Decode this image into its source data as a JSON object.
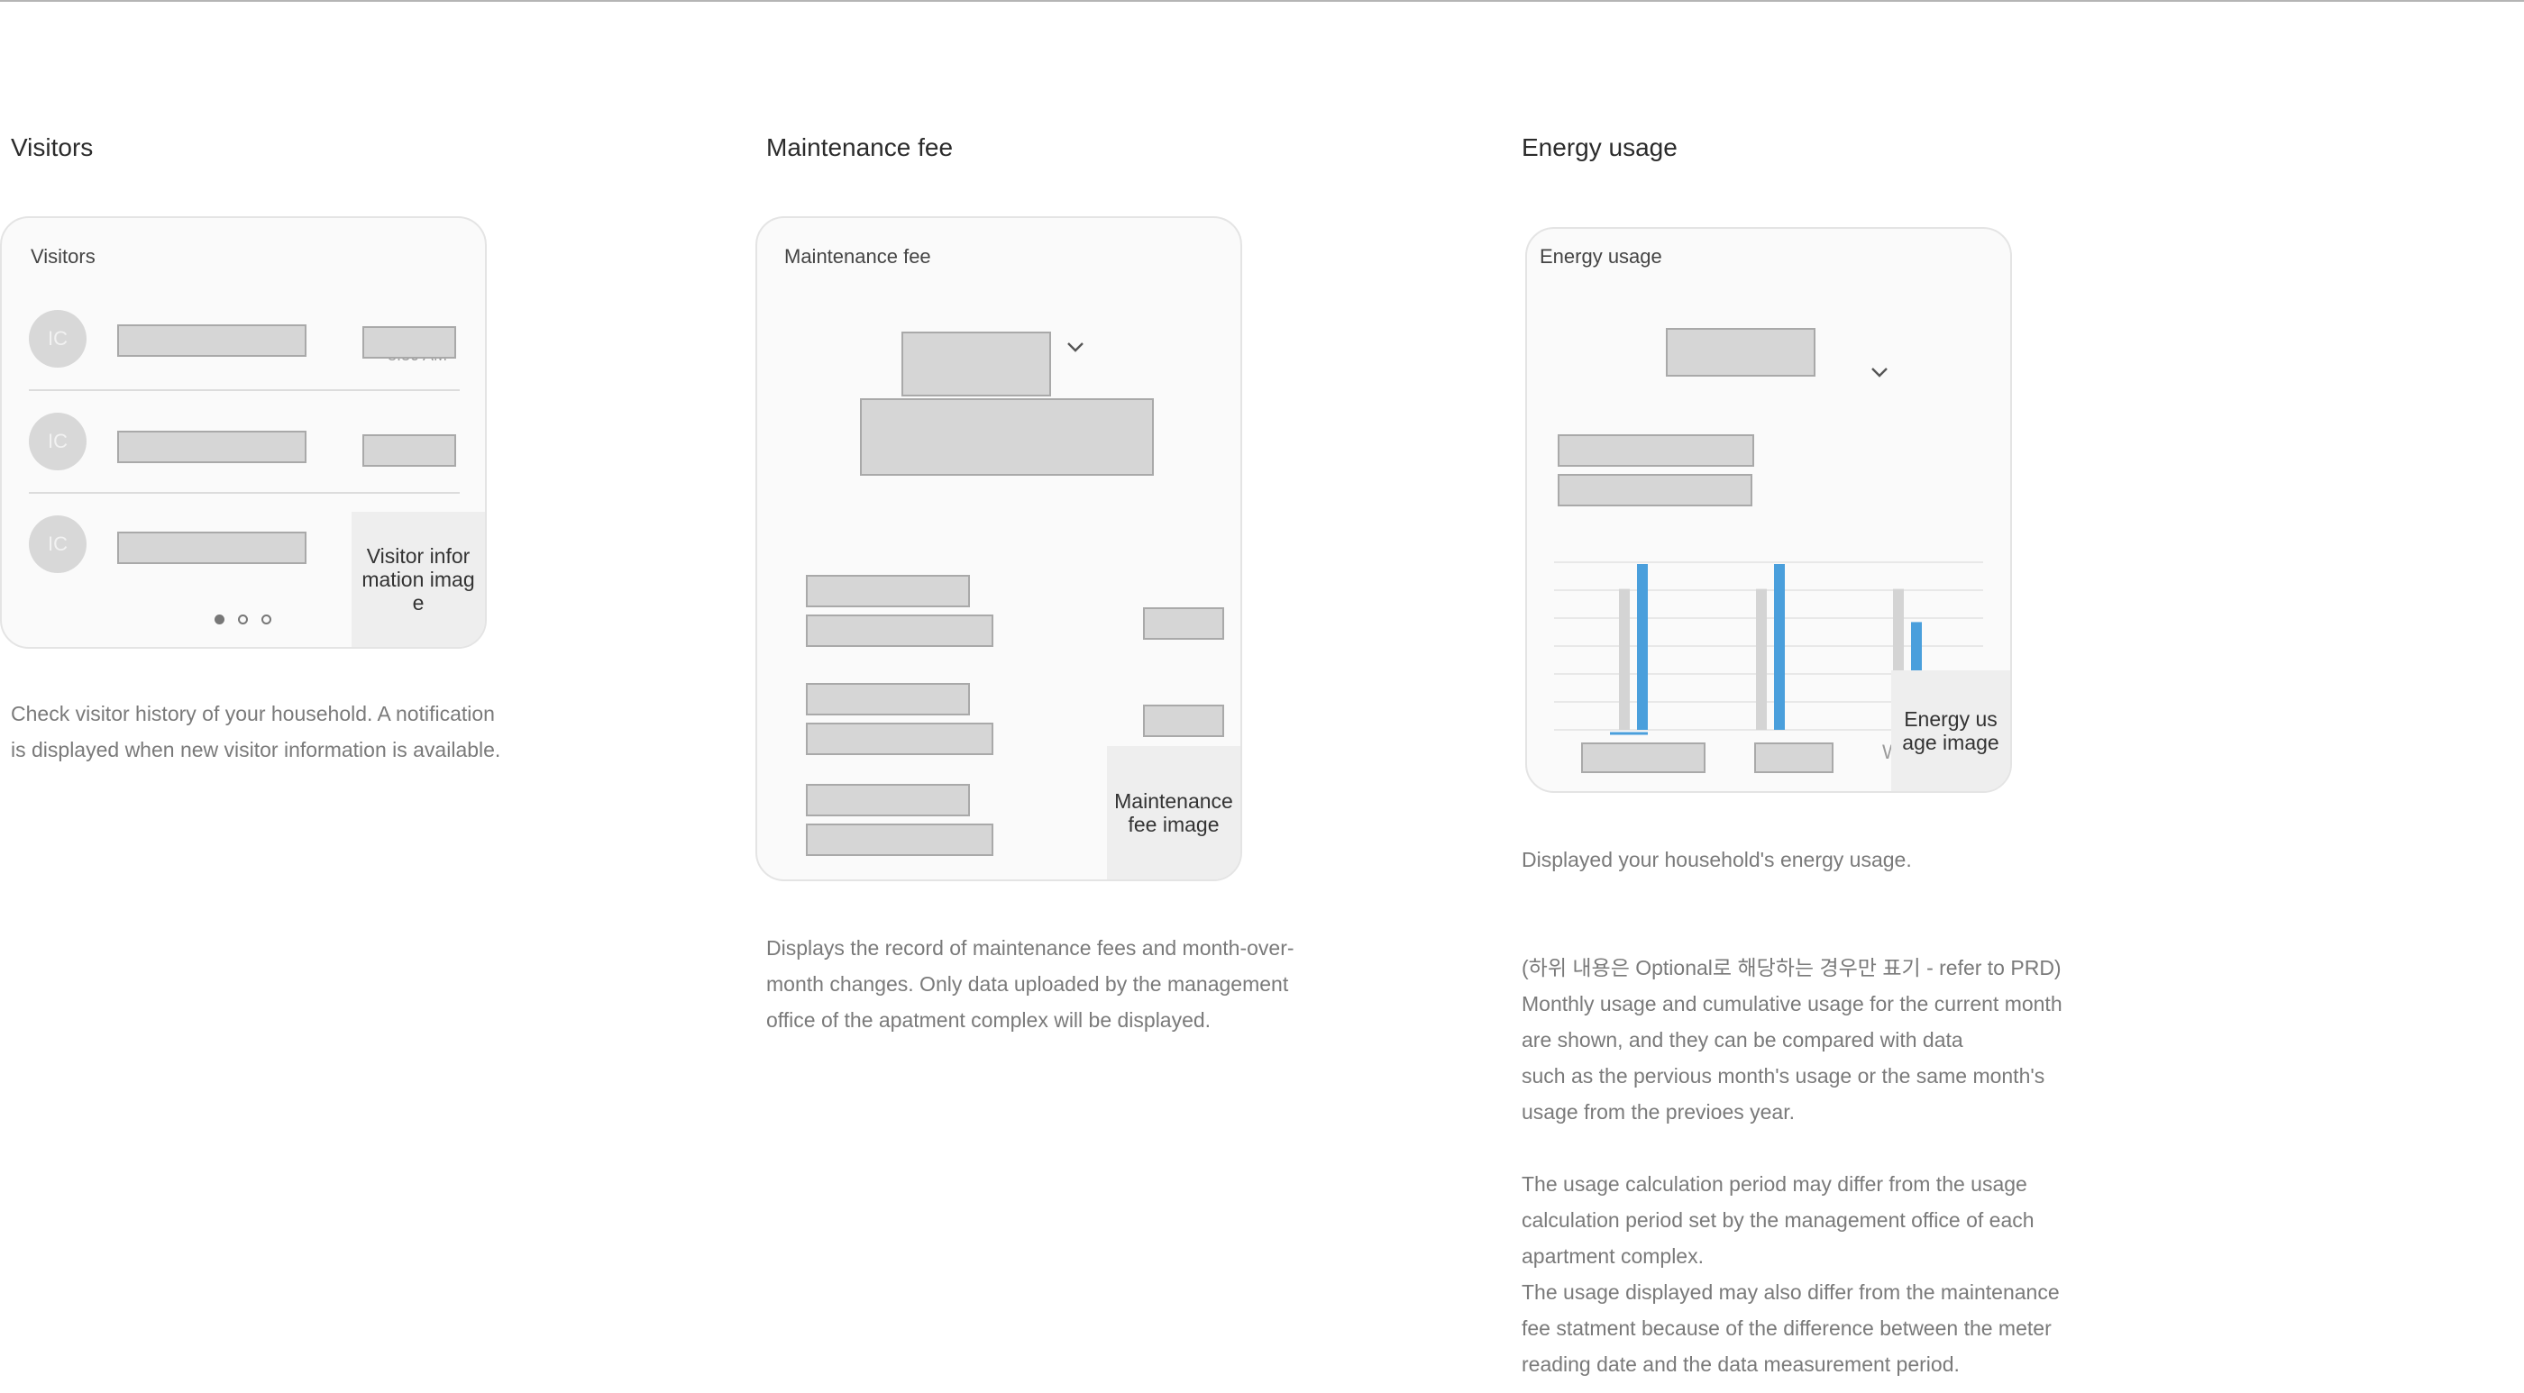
{
  "sections": {
    "visitors": {
      "heading": "Visitors",
      "card_title": "Visitors",
      "avatar_label": "IC",
      "time_text": "8:30 AM",
      "image_label": "Visitor information image",
      "description": [
        "Check visitor history of your household. A notification",
        "is displayed when new visitor information is available."
      ],
      "pagination": {
        "pages": 3,
        "active": 1
      }
    },
    "maintenance": {
      "heading": "Maintenance fee",
      "card_title": "Maintenance fee",
      "image_label": "Maintenance fee image",
      "description": [
        "Displays the record of maintenance fees and month-over-",
        "month changes. Only data uploaded by the management",
        "office of the apatment complex will be displayed."
      ]
    },
    "energy": {
      "heading": "Energy usage",
      "card_title": "Energy usage",
      "image_label": "Energy usage image",
      "axis_hint": "W",
      "description_main": "Displayed your household's energy usage.",
      "description_optional": [
        "(하위 내용은 Optional로 해당하는 경우만 표기 - refer to PRD)",
        "Monthly usage and cumulative usage for the current month",
        "are shown, and they can be compared with data",
        "such as the pervious month's usage or the same month's",
        "usage from the previoes year.",
        "",
        "The usage calculation period may differ from the usage",
        "calculation period set by the management office of each",
        "apartment complex.",
        "The usage displayed may also differ from the maintenance",
        "fee statment because of the difference between the meter",
        "reading date and the data measurement period."
      ]
    }
  },
  "icons": {
    "dropdown": "chevron-down-icon"
  },
  "colors": {
    "accent_bar": "#4a9fdc",
    "compare_bar": "#d4d4d4",
    "placeholder": "#d6d6d6"
  },
  "chart_data": {
    "type": "bar",
    "title": "",
    "xlabel": "",
    "ylabel": "",
    "categories": [
      "",
      "",
      ""
    ],
    "series": [
      {
        "values": [
          85,
          85,
          85
        ]
      },
      {
        "values": [
          100,
          100,
          65
        ]
      }
    ],
    "ylim": [
      0,
      100
    ],
    "grid": true
  }
}
